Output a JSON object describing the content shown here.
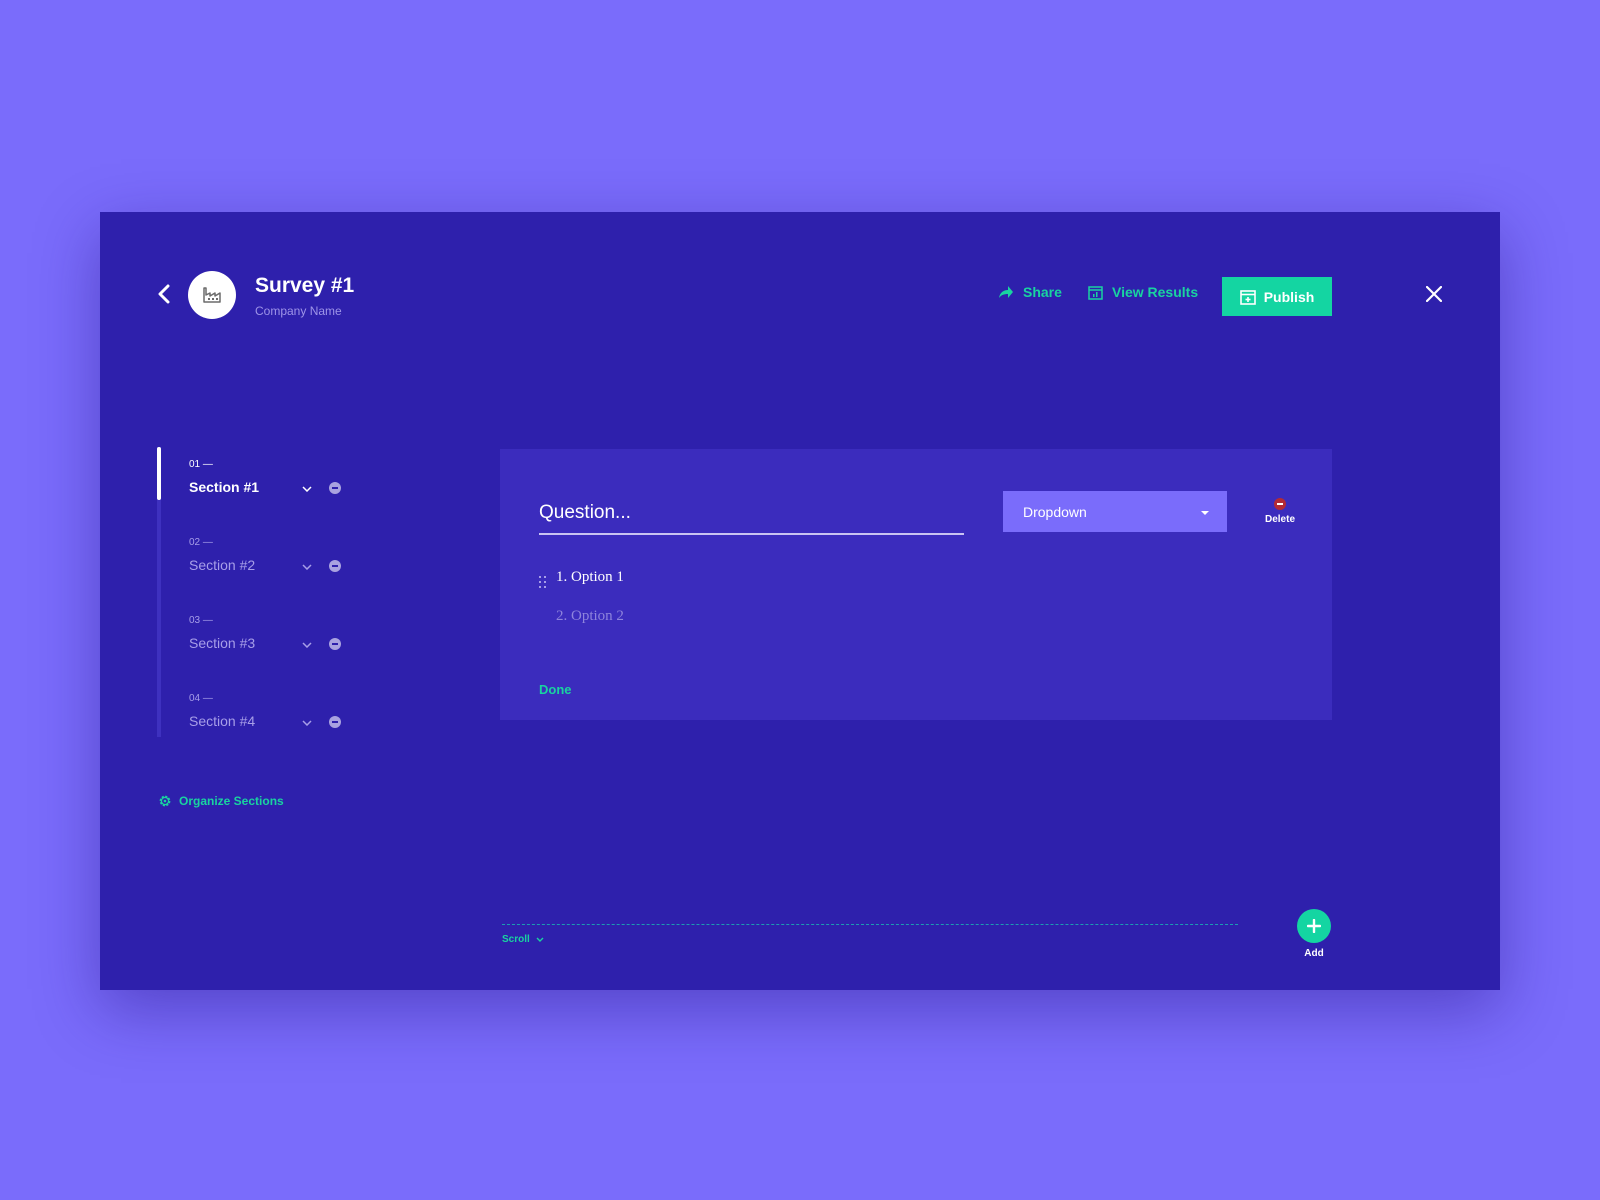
{
  "header": {
    "title": "Survey #1",
    "subtitle": "Company Name",
    "avatar_icon": "factory-icon",
    "actions": {
      "share": "Share",
      "view_results": "View Results",
      "publish": "Publish"
    }
  },
  "sidebar": {
    "sections": [
      {
        "number": "01 —",
        "label": "Section #1",
        "active": true
      },
      {
        "number": "02 —",
        "label": "Section #2",
        "active": false
      },
      {
        "number": "03 —",
        "label": "Section #3",
        "active": false
      },
      {
        "number": "04 —",
        "label": "Section #4",
        "active": false
      }
    ],
    "organize_label": "Organize Sections"
  },
  "question": {
    "placeholder": "Question...",
    "value": "",
    "type": "Dropdown",
    "delete_label": "Delete",
    "options": [
      "1. Option 1",
      "2. Option 2"
    ],
    "done_label": "Done"
  },
  "footer": {
    "scroll_label": "Scroll",
    "add_label": "Add"
  },
  "colors": {
    "page_background": "#7a6cfb",
    "window_background": "#2e20ac",
    "card_background": "#3b2cbd",
    "accent": "#14d5a2",
    "select_background": "#7a6cfb",
    "delete": "#b22a36"
  }
}
